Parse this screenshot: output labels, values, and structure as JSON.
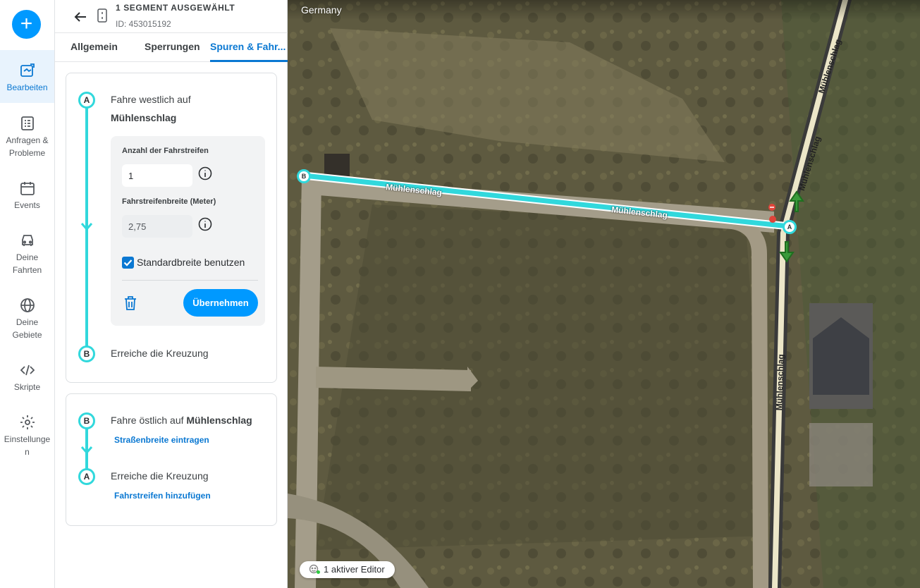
{
  "nav": {
    "add_label": "+",
    "items": [
      {
        "label": "Bearbeiten",
        "icon": "edit-map-icon"
      },
      {
        "label": "Anfragen &\nProbleme",
        "icon": "requests-icon"
      },
      {
        "label": "Events",
        "icon": "calendar-icon"
      },
      {
        "label": "Deine\nFahrten",
        "icon": "car-icon"
      },
      {
        "label": "Deine\nGebiete",
        "icon": "globe-icon"
      },
      {
        "label": "Skripte",
        "icon": "code-icon"
      },
      {
        "label": "Einstellunge\nn",
        "icon": "gear-icon"
      }
    ]
  },
  "panel": {
    "title": "1 SEGMENT AUSGEWÄHLT",
    "id_text": "ID: 453015192",
    "tabs": [
      "Allgemein",
      "Sperrungen",
      "Spuren & Fahr..."
    ],
    "active_tab": 2
  },
  "direction1": {
    "start_node": "A",
    "line1": "Fahre westlich auf",
    "line2": "Mühlenschlag",
    "lanes_label": "Anzahl der Fahrstreifen",
    "lanes_value": "1",
    "width_label": "Fahrstreifenbreite (Meter)",
    "width_value": "2,75",
    "default_width_label": "Standardbreite benutzen",
    "default_width_checked": true,
    "apply_label": "Übernehmen",
    "end_node": "B",
    "end_text": "Erreiche die Kreuzung"
  },
  "direction2": {
    "start_node": "B",
    "line1_prefix": "Fahre östlich auf ",
    "line1_street": "Mühlenschlag",
    "link1": "Straßenbreite eintragen",
    "end_node": "A",
    "end_text": "Erreiche die Kreuzung",
    "link2": "Fahrstreifen hinzufügen"
  },
  "map": {
    "country": "Germany",
    "street_label": "Mühlenschlag",
    "node_a": "A",
    "node_b": "B",
    "editors_label": "1 aktiver Editor"
  },
  "colors": {
    "accent": "#0099ff",
    "link": "#0a78d2",
    "segment": "#31d8dc"
  }
}
